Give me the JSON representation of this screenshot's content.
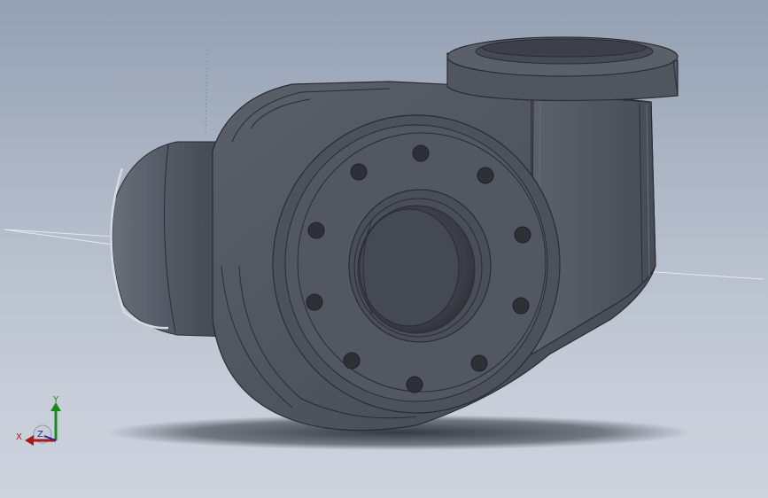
{
  "viewport": {
    "background_top": "#94a0b3",
    "background_bottom": "#cdd3dd",
    "body_color": "#4e525d",
    "edge_color": "#2a2c33"
  },
  "triad": {
    "x_label": "X",
    "y_label": "Y",
    "z_label": "Z",
    "x_color": "#b01818",
    "y_color": "#1a8a1a",
    "z_color": "#1a2aa0"
  }
}
